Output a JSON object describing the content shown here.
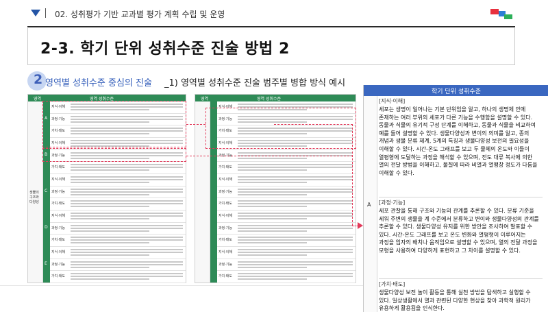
{
  "header": {
    "chapter": "02. 성취평가 기반 교과별 평가 계획 수립 및 운영",
    "title": "2-3. 학기 단위 성취수준 진술 방법 2"
  },
  "section": {
    "number": "2",
    "title": "영역별 성취수준 중심의 진술",
    "subtitle": "_1) 영역별 성취수준 진술 범주별 병합  방식 예시"
  },
  "doc1": {
    "col1": "영역",
    "col2": "영역 성취수준",
    "area_label": "생물의 구조와 다양성",
    "rows": [
      {
        "letter": "A",
        "labels": [
          "지식·이해",
          "과정·기능",
          "가치·태도"
        ]
      },
      {
        "letter": "B",
        "labels": [
          "지식·이해",
          "과정·기능",
          "가치·태도"
        ]
      },
      {
        "letter": "C",
        "labels": [
          "지식·이해",
          "과정·기능",
          "가치·태도"
        ]
      },
      {
        "letter": "D",
        "labels": [
          "지식·이해",
          "과정·기능",
          "가치·태도"
        ]
      },
      {
        "letter": "E",
        "labels": [
          "지식·이해",
          "과정·기능",
          "가치·태도"
        ]
      }
    ]
  },
  "doc2": {
    "col1": "영역",
    "col2": "영역 성취수준",
    "rows": [
      "지식·이해",
      "과정·기능",
      "가치·태도",
      "지식·이해",
      "과정·기능",
      "가치·태도",
      "지식·이해",
      "과정·기능",
      "가치·태도",
      "지식·이해",
      "과정·기능",
      "가치·태도",
      "지식·이해",
      "과정·기능",
      "가치·태도"
    ]
  },
  "panel": {
    "header": "학기 단위 성취수준",
    "level": "A",
    "blocks": [
      {
        "tag": "[지식·이해]",
        "text": "세포는 생명이 일어나는 기본 단위임을 알고, 하나의 생명체 안에 존재하는 여러 부위의 세포가 다른 기능을 수행함을 설명할 수 있다. 동물과 식물의 유기적 구성 단계를 이해하고, 동물과 식물을 비교하여 예를 들어 설명할 수 있다. 생물다양성과 변이의 의미를 알고, 종의 개념과 생물 분류 체계, 5계의 특징과 생물다양성 보전의 필요성을 이해할 수 있다. 시간-온도 그래프를 보고 두 물체의 온도와 이들이 열평형에 도달하는 과정을 해석할 수 있으며, 전도 대류 복사에 의한 열의 전달 방법을 이해하고, 물질에 따라 비열과 열팽창 정도가 다름을 이해할 수 있다."
      },
      {
        "tag": "[과정·기능]",
        "text": "세포 관찰을 통해 구조와 기능의 관계를 추론할 수 있다. 분류 기준을 세워 주변의 생물을 계 수준에서 분류하고 변이와 생물다양성의 관계를 추론할 수 있다. 생물다양성 유지를 위한 방안을 조사하여 발표할 수 있다. 시간-온도 그래프를 보고 온도 변화와 열평형이 이루어지는 과정을 입자의 배치나 움직임으로 설명할 수 있으며, 열의 전달 과정을 모형을 사용하여 다양하게 표현하고 그 차이를 설명할 수 있다."
      },
      {
        "tag": "[가치·태도]",
        "text": "생물다양성 보전 놀이 활동을 통해 실천 방법을 탐색하고 실행할 수 있다. 일상생활에서 열과 관련된 다양한 현상을 찾아 과학적 원리가 유용하게 활용됨을 인식한다."
      }
    ]
  },
  "colors": {
    "accent_blue": "#3a67c0",
    "doc_green": "#2e8b57",
    "dash_red": "#e23a5a"
  }
}
